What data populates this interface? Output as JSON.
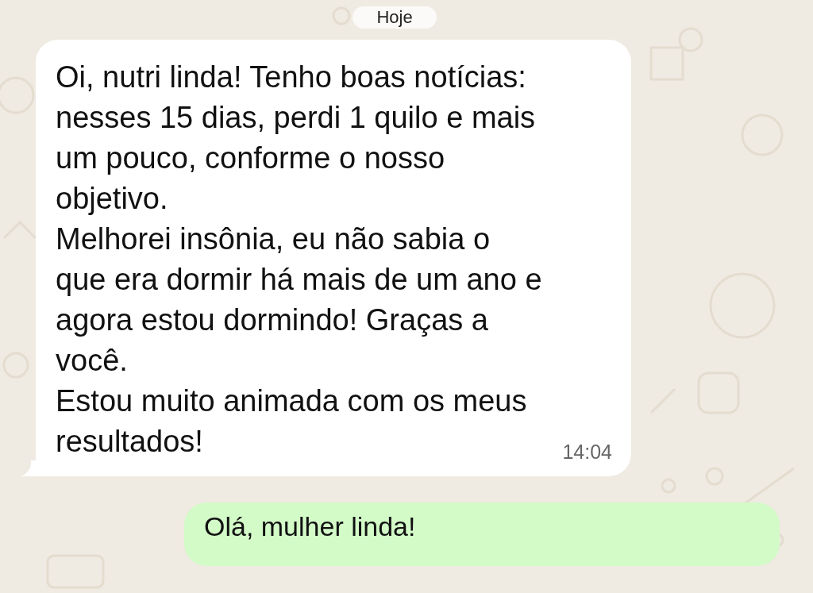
{
  "date_chip": "Hoje",
  "messages": [
    {
      "kind": "incoming",
      "lines": [
        "Oi, nutri linda! Tenho boas notícias: nesses 15 dias, perdi 1 quilo e mais um pouco, conforme o nosso objetivo.",
        "Melhorei insônia, eu não sabia o que era dormir há mais de um ano e agora estou dormindo! Graças a você.",
        "Estou muito animada com os meus resultados!"
      ],
      "time": "14:04"
    },
    {
      "kind": "outgoing",
      "lines": [
        "Olá, mulher linda!"
      ]
    }
  ]
}
